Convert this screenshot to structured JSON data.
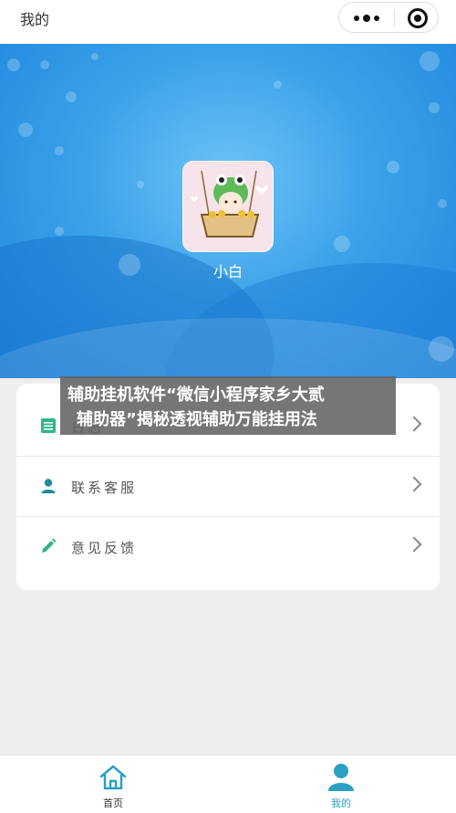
{
  "topbar": {
    "title": "我的"
  },
  "profile": {
    "nickname": "小白"
  },
  "menu": {
    "items": [
      {
        "label": "日志",
        "icon": "list-icon"
      },
      {
        "label": "联系客服",
        "icon": "person-icon"
      },
      {
        "label": "意见反馈",
        "icon": "pencil-icon"
      }
    ]
  },
  "overlay": {
    "line1": "辅助挂机软件“微信小程序家乡大贰",
    "line2": "辅助器”揭秘透视辅助万能挂用法"
  },
  "tabbar": {
    "items": [
      {
        "label": "首页",
        "icon": "home-icon"
      },
      {
        "label": "我的",
        "icon": "user-icon",
        "active": true
      }
    ]
  },
  "colors": {
    "accent": "#2aa0c4",
    "banner": "#3aa2ea",
    "list_icon": "#2fb58a",
    "person_icon": "#1f8e9a"
  }
}
